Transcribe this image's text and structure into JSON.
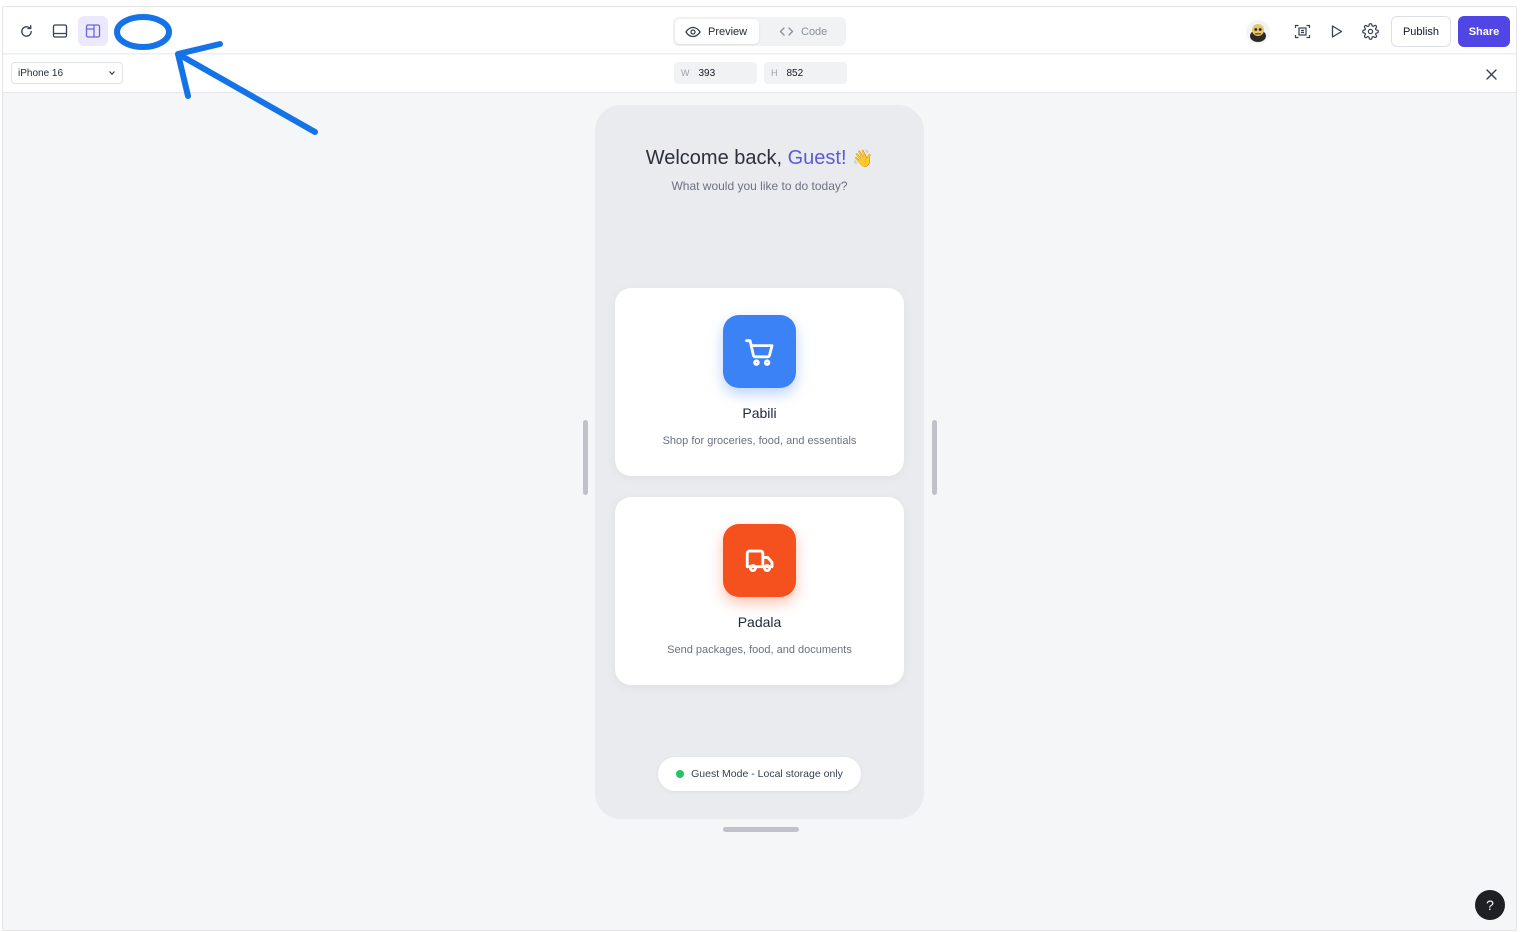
{
  "toolbar": {
    "icons": [
      "refresh-icon",
      "layout-single-icon",
      "layout-split-icon"
    ],
    "view_toggle": {
      "preview_label": "Preview",
      "code_label": "Code",
      "active": "Preview"
    },
    "right_icons": [
      "avatar",
      "scan-icon",
      "play-icon",
      "gear-icon"
    ],
    "publish_label": "Publish",
    "share_label": "Share"
  },
  "device_bar": {
    "device": "iPhone 16",
    "width_label": "W",
    "width_value": "393",
    "height_label": "H",
    "height_value": "852"
  },
  "app": {
    "welcome_prefix": "Welcome back, ",
    "welcome_name": "Guest!",
    "welcome_emoji": "👋",
    "subtitle": "What would you like to do today?",
    "cards": [
      {
        "title": "Pabili",
        "description": "Shop for groceries, food, and essentials",
        "icon": "cart-icon",
        "color": "#3b82f6"
      },
      {
        "title": "Padala",
        "description": "Send packages, food, and documents",
        "icon": "truck-icon",
        "color": "#f4511e"
      }
    ],
    "status": {
      "text": "Guest Mode - Local storage only",
      "dot_color": "#22c55e"
    }
  },
  "help_label": "?",
  "colors": {
    "accent": "#4f46e5",
    "welcome_name": "#5b5bd6",
    "annotation": "#1473e6"
  }
}
